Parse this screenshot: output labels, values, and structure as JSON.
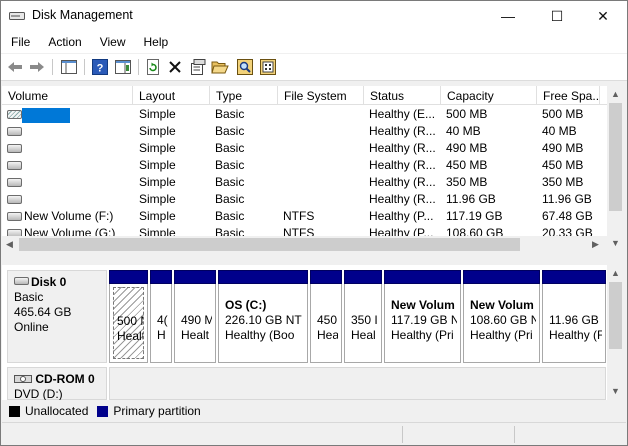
{
  "window": {
    "title": "Disk Management",
    "minimize": "—",
    "maximize": "☐",
    "close": "✕"
  },
  "menu": [
    "File",
    "Action",
    "View",
    "Help"
  ],
  "toolbar": [
    "back-icon",
    "forward-icon",
    "show-hide-console-tree-icon",
    "help-icon",
    "show-hide-action-pane-icon",
    "refresh-icon",
    "delete-icon",
    "properties-icon",
    "open-folder-icon",
    "explore-icon",
    "disk-wizard-icon"
  ],
  "columns": [
    "Volume",
    "Layout",
    "Type",
    "File System",
    "Status",
    "Capacity",
    "Free Spa..."
  ],
  "volumes": [
    {
      "volume": "",
      "layout": "Simple",
      "type": "Basic",
      "fs": "",
      "status": "Healthy (E...",
      "capacity": "500 MB",
      "free": "500 MB"
    },
    {
      "volume": "",
      "layout": "Simple",
      "type": "Basic",
      "fs": "",
      "status": "Healthy (R...",
      "capacity": "40 MB",
      "free": "40 MB"
    },
    {
      "volume": "",
      "layout": "Simple",
      "type": "Basic",
      "fs": "",
      "status": "Healthy (R...",
      "capacity": "490 MB",
      "free": "490 MB"
    },
    {
      "volume": "",
      "layout": "Simple",
      "type": "Basic",
      "fs": "",
      "status": "Healthy (R...",
      "capacity": "450 MB",
      "free": "450 MB"
    },
    {
      "volume": "",
      "layout": "Simple",
      "type": "Basic",
      "fs": "",
      "status": "Healthy (R...",
      "capacity": "350 MB",
      "free": "350 MB"
    },
    {
      "volume": "",
      "layout": "Simple",
      "type": "Basic",
      "fs": "",
      "status": "Healthy (R...",
      "capacity": "11.96 GB",
      "free": "11.96 GB"
    },
    {
      "volume": "New Volume (F:)",
      "layout": "Simple",
      "type": "Basic",
      "fs": "NTFS",
      "status": "Healthy (P...",
      "capacity": "117.19 GB",
      "free": "67.48 GB"
    },
    {
      "volume": "New Volume (G:)",
      "layout": "Simple",
      "type": "Basic",
      "fs": "NTFS",
      "status": "Healthy (P...",
      "capacity": "108.60 GB",
      "free": "20.33 GB"
    }
  ],
  "disk0": {
    "name": "Disk 0",
    "type": "Basic",
    "size": "465.64 GB",
    "state": "Online",
    "partitions": [
      {
        "line1": "",
        "line2": "500 M",
        "line3": "Healt"
      },
      {
        "line1": "",
        "line2": "4(",
        "line3": "H"
      },
      {
        "line1": "",
        "line2": "490 M",
        "line3": "Healt"
      },
      {
        "line1": "OS  (C:)",
        "line2": "226.10 GB NT",
        "line3": "Healthy (Boo"
      },
      {
        "line1": "",
        "line2": "450 M",
        "line3": "Heal"
      },
      {
        "line1": "",
        "line2": "350 I",
        "line3": "Heal"
      },
      {
        "line1": "New Volum",
        "line2": "117.19 GB N",
        "line3": "Healthy (Pri"
      },
      {
        "line1": "New Volum",
        "line2": "108.60 GB N",
        "line3": "Healthy (Pri"
      },
      {
        "line1": "",
        "line2": "11.96 GB",
        "line3": "Healthy (F"
      }
    ]
  },
  "cdrom0": {
    "name": "CD-ROM 0",
    "drive": "DVD (D:)"
  },
  "legend": [
    {
      "label": "Unallocated",
      "color": "#000000"
    },
    {
      "label": "Primary partition",
      "color": "#00008b"
    }
  ]
}
